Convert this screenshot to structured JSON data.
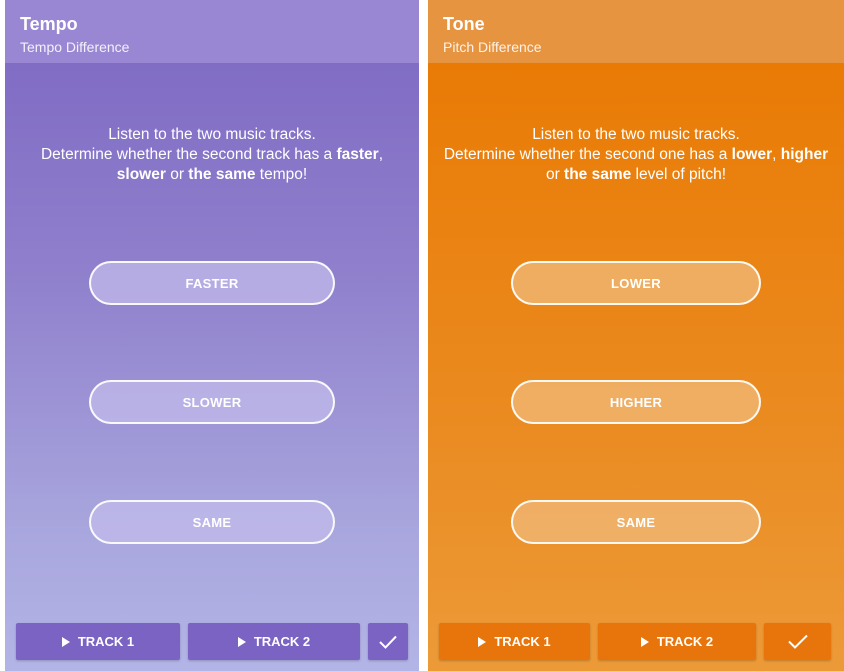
{
  "left_panel": {
    "title": "Tempo",
    "subtitle": "Tempo Difference",
    "instructions": {
      "line1": "Listen to the two music tracks.",
      "line2_pre": "Determine whether the second track has a ",
      "line2_b1": "faster",
      "line2_post": ",",
      "line3_b1": "slower",
      "line3_mid": " or ",
      "line3_b2": "the same",
      "line3_post": " tempo!"
    },
    "choices": [
      "FASTER",
      "SLOWER",
      "SAME"
    ],
    "buttons": {
      "track1": "TRACK 1",
      "track2": "TRACK 2"
    },
    "colors": {
      "appbar": "#9a87d3",
      "body": "#7c67c2",
      "button": "#7b63c4"
    }
  },
  "right_panel": {
    "title": "Tone",
    "subtitle": "Pitch Difference",
    "instructions": {
      "line1": "Listen to the two music tracks.",
      "line2_pre": "Determine whether the second one has a ",
      "line2_b1": "lower",
      "line2_mid": ", ",
      "line2_b2": "higher",
      "line3_pre": "or ",
      "line3_b1": "the same",
      "line3_post": " level of pitch!"
    },
    "choices": [
      "LOWER",
      "HIGHER",
      "SAME"
    ],
    "buttons": {
      "track1": "TRACK 1",
      "track2": "TRACK 2"
    },
    "colors": {
      "appbar": "#e79440",
      "body": "#e97800",
      "button": "#e8750b"
    }
  },
  "icons": {
    "play": "play-icon",
    "submit": "check-icon"
  }
}
